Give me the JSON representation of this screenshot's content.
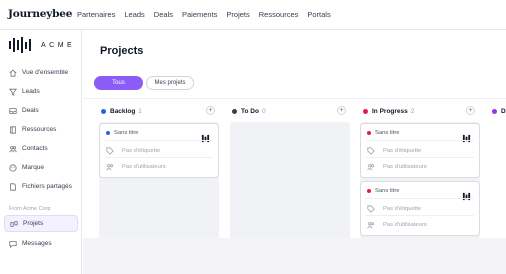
{
  "brand": "Journeybee",
  "topnav": [
    "Partenaires",
    "Leads",
    "Deals",
    "Paiements",
    "Projets",
    "Ressources",
    "Portals"
  ],
  "logo_text": "ACME",
  "sidebar": {
    "items": [
      {
        "label": "Vue d'ensemble",
        "icon": "home-icon"
      },
      {
        "label": "Leads",
        "icon": "funnel-icon"
      },
      {
        "label": "Deals",
        "icon": "inbox-icon"
      },
      {
        "label": "Ressources",
        "icon": "book-icon"
      },
      {
        "label": "Contacts",
        "icon": "users-icon"
      },
      {
        "label": "Marque",
        "icon": "palette-icon"
      },
      {
        "label": "Fichiers partagés",
        "icon": "file-icon"
      }
    ],
    "section_label": "From Acme Corp",
    "section_items": [
      {
        "label": "Projets",
        "icon": "project-icon",
        "active": true
      },
      {
        "label": "Messages",
        "icon": "chat-icon"
      }
    ]
  },
  "main": {
    "title": "Projects",
    "tabs": [
      {
        "label": "Tous",
        "active": true
      },
      {
        "label": "Mes projets",
        "active": false
      }
    ]
  },
  "columns": [
    {
      "name": "Backlog",
      "count": "1",
      "color": "#2563eb"
    },
    {
      "name": "To Do",
      "count": "0",
      "color": "#374151"
    },
    {
      "name": "In Progress",
      "count": "2",
      "color": "#e11d48"
    },
    {
      "name": "D",
      "count": "",
      "color": "#9333ea"
    }
  ],
  "cards": {
    "backlog": [
      {
        "title": "Sans titre",
        "tag": "Pas d'étiquette",
        "user": "Pas d'utilisateurs",
        "dot_color": "#2563eb"
      }
    ],
    "in_progress": [
      {
        "title": "Sans titre",
        "tag": "Pas d'étiquette",
        "user": "Pas d'utilisateurs",
        "dot_color": "#e11d48"
      },
      {
        "title": "Sans titre",
        "tag": "Pas d'étiquette",
        "user": "Pas d'utilisateurs",
        "dot_color": "#e11d48"
      }
    ]
  }
}
